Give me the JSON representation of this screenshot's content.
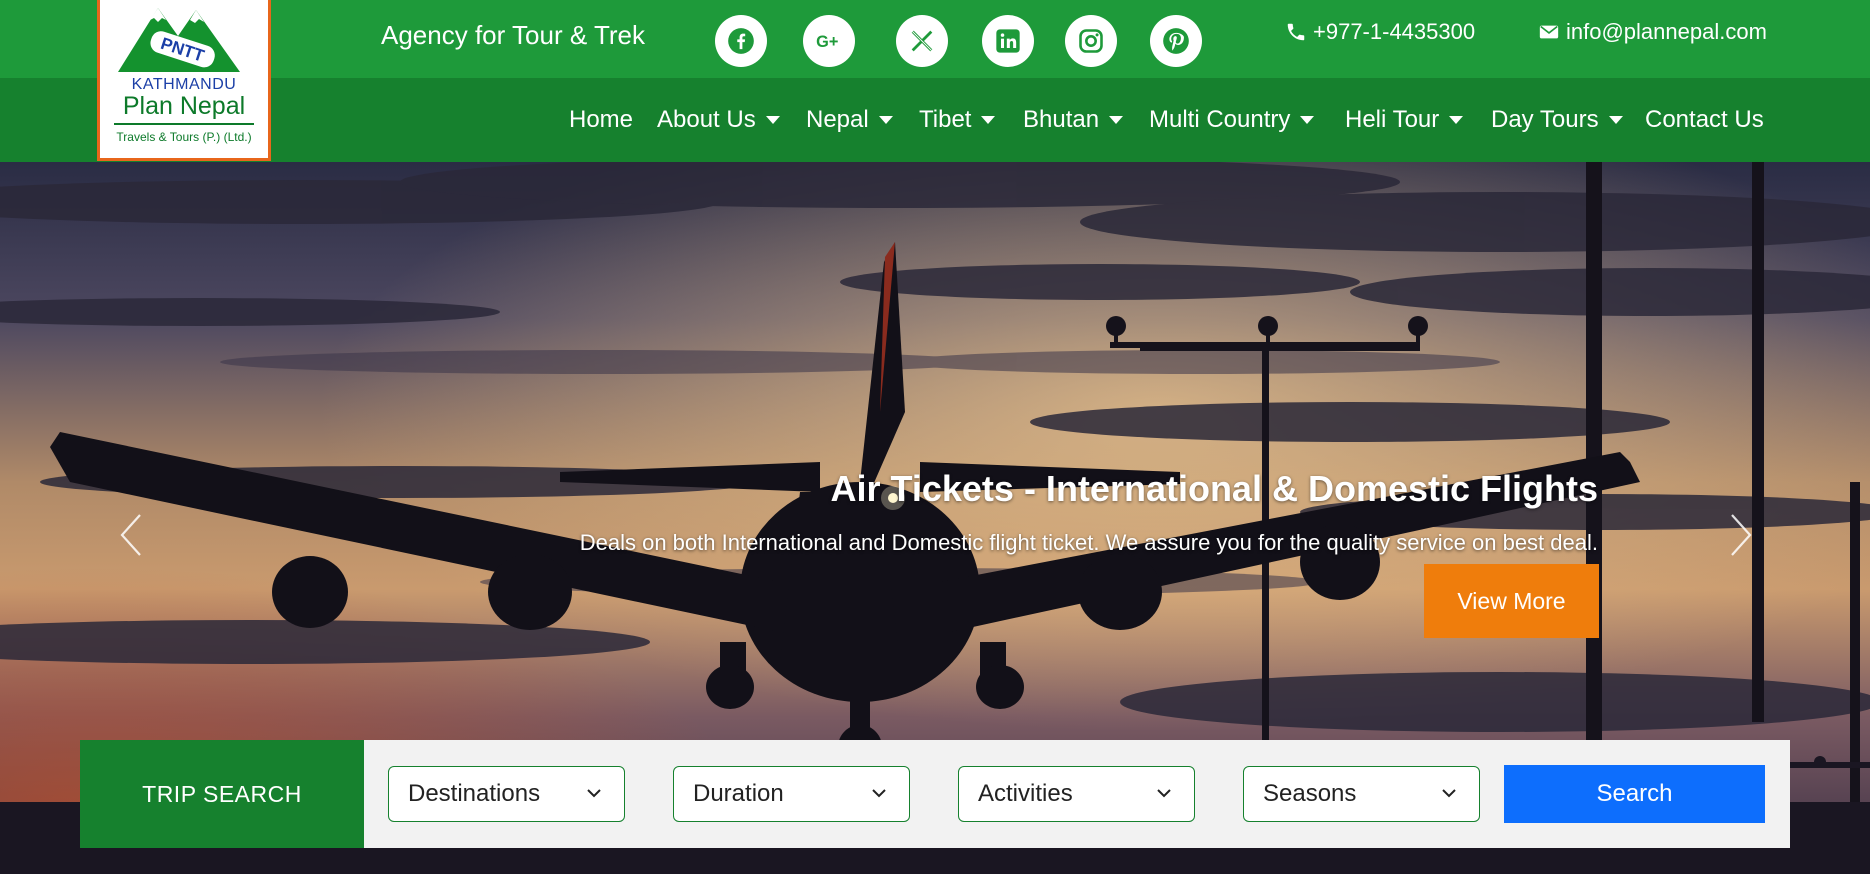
{
  "header": {
    "tagline": "Agency for Tour & Trek",
    "phone": "+977-1-4435300",
    "email": "info@plannepal.com",
    "social_icons": [
      "facebook-icon",
      "google-plus-icon",
      "x-icon",
      "linkedin-icon",
      "instagram-icon",
      "pinterest-icon"
    ]
  },
  "logo": {
    "badge": "PNTT",
    "city": "KATHMANDU",
    "brand": "Plan Nepal",
    "subtitle": "Travels & Tours (P.) (Ltd.)"
  },
  "nav": {
    "items": [
      {
        "label": "Home",
        "dropdown": false
      },
      {
        "label": "About Us",
        "dropdown": true
      },
      {
        "label": "Nepal",
        "dropdown": true
      },
      {
        "label": "Tibet",
        "dropdown": true
      },
      {
        "label": "Bhutan",
        "dropdown": true
      },
      {
        "label": "Multi Country",
        "dropdown": true
      },
      {
        "label": "Heli Tour",
        "dropdown": true
      },
      {
        "label": "Day Tours",
        "dropdown": true
      },
      {
        "label": "Contact Us",
        "dropdown": false
      }
    ]
  },
  "slide": {
    "title": "Air Tickets - International & Domestic Flights",
    "description": "Deals on both International and Domestic flight ticket. We assure you for the quality service on best deal.",
    "button": "View More"
  },
  "trip_search": {
    "label": "TRIP SEARCH",
    "selects": [
      "Destinations",
      "Duration",
      "Activities",
      "Seasons"
    ],
    "button": "Search"
  },
  "colors": {
    "topbar": "#1e9a3a",
    "navbar": "#16812e",
    "accent_orange": "#ef7d0c",
    "search_blue": "#0d6efd"
  }
}
